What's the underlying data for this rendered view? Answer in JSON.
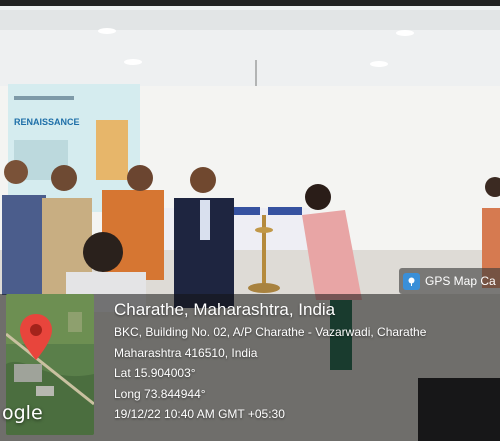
{
  "photo": {
    "description_icon": "event-photo",
    "poster_headline": "RENAISSANCE"
  },
  "gps_badge": {
    "icon": "gps-map-camera-icon",
    "label": "GPS Map Ca"
  },
  "location": {
    "place": "Charathe, Maharashtra, India",
    "address_line1": "BKC, Building No. 02, A/P Charathe - Vazarwadi, Charathe",
    "address_line2": "Maharashtra 416510, India",
    "latitude": "Lat 15.904003°",
    "longitude": "Long 73.844944°",
    "timestamp": "19/12/22 10:40 AM GMT +05:30"
  },
  "map": {
    "watermark": "ogle",
    "pin_color": "#e8453c"
  }
}
